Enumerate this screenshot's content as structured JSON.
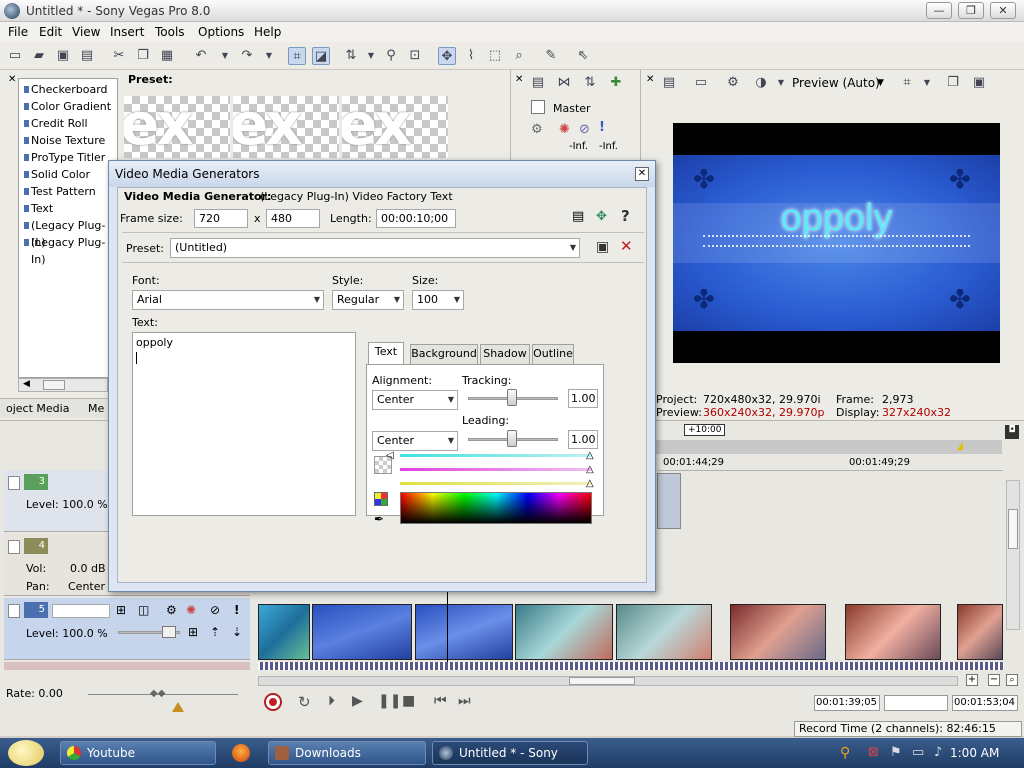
{
  "window": {
    "title": "Untitled * - Sony Vegas Pro 8.0"
  },
  "menu": [
    "File",
    "Edit",
    "View",
    "Insert",
    "Tools",
    "Options",
    "Help"
  ],
  "generators": {
    "items": [
      "Checkerboard",
      "Color Gradient",
      "Credit Roll",
      "Noise Texture",
      "ProType Titler",
      "Solid Color",
      "Test Pattern",
      "Text",
      "(Legacy Plug-In)",
      "(Legacy Plug-In)"
    ],
    "preset_label": "Preset:",
    "thumb_text": "ex",
    "tabs": [
      "oject Media",
      "Me"
    ]
  },
  "mixer": {
    "master": "Master",
    "inf_left": "-Inf.",
    "inf_right": "-Inf."
  },
  "preview": {
    "mode": "Preview (Auto)",
    "video_title": "oppoly",
    "project_label": "Project:",
    "project_value": "720x480x32, 29.970i",
    "preview_label": "Preview:",
    "preview_value": "360x240x32, 29.970p",
    "frame_label": "Frame:",
    "frame_value": "2,973",
    "display_label": "Display:",
    "display_value": "327x240x32"
  },
  "dialog": {
    "title": "Video Media Generators",
    "subtitle_bold": "Video Media Generator:",
    "subtitle_rest": "(Legacy Plug-In) Video Factory Text",
    "frame_size_label": "Frame size:",
    "width": "720",
    "x": "x",
    "height": "480",
    "length_label": "Length:",
    "length": "00:00:10;00",
    "preset_label": "Preset:",
    "preset": "(Untitled)",
    "font_label": "Font:",
    "font": "Arial",
    "style_label": "Style:",
    "style": "Regular",
    "size_label": "Size:",
    "size": "100",
    "text_label": "Text:",
    "text_value": "oppoly",
    "tabs": [
      "Text",
      "Background",
      "Shadow",
      "Outline"
    ],
    "alignment_label": "Alignment:",
    "alignment": "Center",
    "alignment2": "Center",
    "tracking_label": "Tracking:",
    "tracking": "1.00",
    "leading_label": "Leading:",
    "leading": "1.00"
  },
  "timeline": {
    "cursor_time": "+10:00",
    "mark1": "00:01:44;29",
    "mark2": "00:01:49;29",
    "track3_num": "3",
    "track3_level": "Level: 100.0 %",
    "track4_num": "4",
    "track4_vol_label": "Vol:",
    "track4_vol": "0.0 dB",
    "track4_pan_label": "Pan:",
    "track4_pan": "Center",
    "track5_num": "5",
    "track5_level": "Level: 100.0 %",
    "rate": "Rate: 0.00",
    "time1": "00:01:39;05",
    "time2": "00:01:53;04",
    "record": "Record Time (2 channels): 82:46:15"
  },
  "taskbar": {
    "items": [
      "Youtube Downloade...",
      "Downloads",
      "Untitled * - Sony Veg..."
    ],
    "clock": "1:00 AM"
  },
  "colors": {
    "accent": "#2a5cd2",
    "taskbar": "#24497a",
    "dialog_bg": "#dde6f2"
  }
}
